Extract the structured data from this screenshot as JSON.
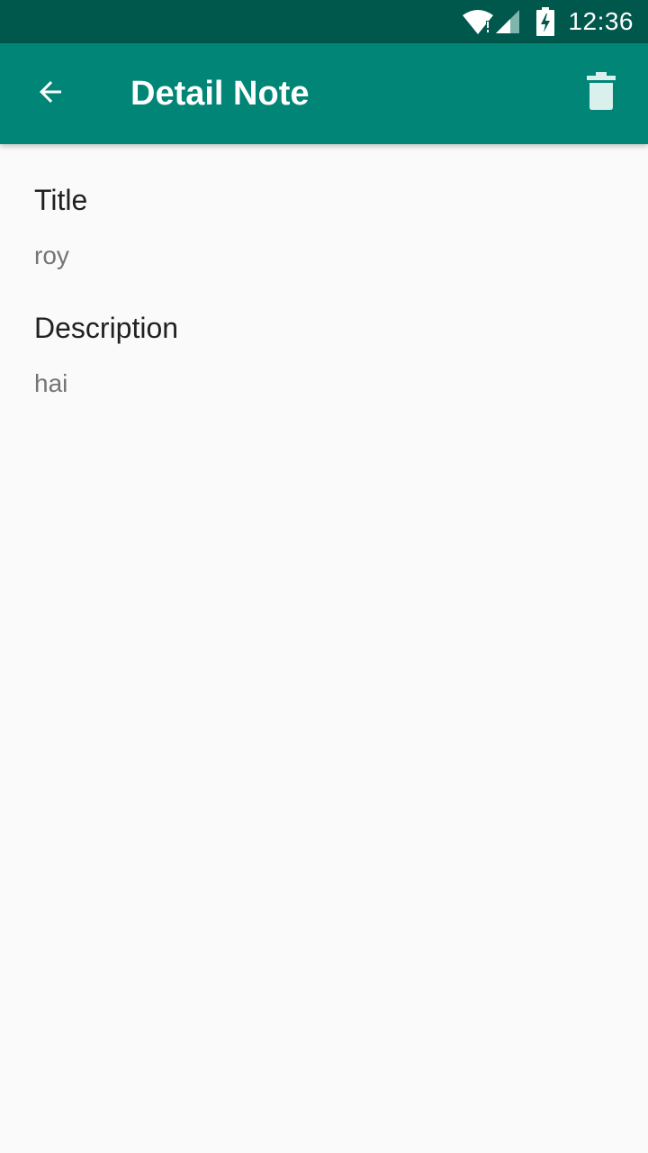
{
  "status_bar": {
    "time": "12:36",
    "icons": [
      "wifi-icon",
      "signal-icon",
      "battery-charging-icon"
    ]
  },
  "app_bar": {
    "title": "Detail Note",
    "back_icon": "arrow-back-icon",
    "delete_icon": "trash-icon",
    "background_color": "#008577",
    "status_bar_color": "#00574b"
  },
  "note": {
    "title_label": "Title",
    "title_value": "roy",
    "description_label": "Description",
    "description_value": "hai"
  }
}
